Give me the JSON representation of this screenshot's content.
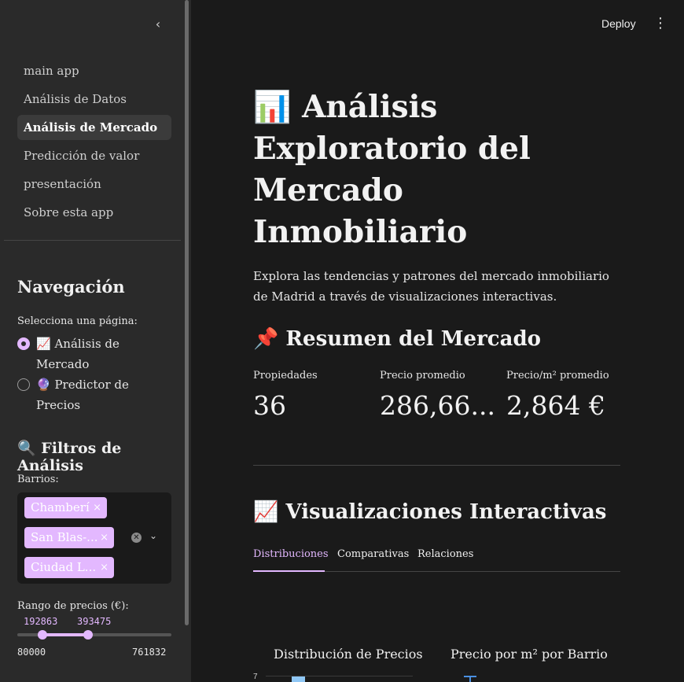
{
  "sidebar": {
    "pages": [
      {
        "label": "main app",
        "active": false
      },
      {
        "label": "Análisis de Datos",
        "active": false
      },
      {
        "label": "Análisis de Mercado",
        "active": true
      },
      {
        "label": "Predicción de valor",
        "active": false
      },
      {
        "label": "presentación",
        "active": false
      },
      {
        "label": "Sobre esta app",
        "active": false
      }
    ],
    "nav_heading": "Navegación",
    "select_label": "Selecciona una página:",
    "radio_options": [
      {
        "label": "📈 Análisis de Mercado",
        "selected": true
      },
      {
        "label": "🔮 Predictor de Precios",
        "selected": false
      }
    ],
    "filters_heading": "🔍 Filtros de Análisis",
    "barrios_label": "Barrios:",
    "barrios_selected": [
      "Chamberí",
      "San Blas-...",
      "Ciudad L..."
    ],
    "chip_remove": "×",
    "price_range_label": "Rango de precios (€):",
    "price_range": {
      "min": 80000,
      "max": 761832,
      "low": 192863,
      "high": 393475
    },
    "price_min_text": "80000",
    "price_max_text": "761832",
    "price_low_text": "192863",
    "price_high_text": "393475"
  },
  "header": {
    "deploy_label": "Deploy",
    "menu_icon": "vertical-dots-icon"
  },
  "main": {
    "title": "📊 Análisis Exploratorio del Mercado Inmobiliario",
    "intro": "Explora las tendencias y patrones del mercado inmobiliario de Madrid a través de visualizaciones interactivas.",
    "summary_heading": "📌 Resumen del Mercado",
    "metrics": [
      {
        "label": "Propiedades",
        "value": "36"
      },
      {
        "label": "Precio promedio",
        "value": "286,66..."
      },
      {
        "label": "Precio/m² promedio",
        "value": "2,864 €"
      }
    ],
    "viz_heading": "📈 Visualizaciones Interactivas",
    "tabs": [
      {
        "label": "Distribuciones",
        "active": true
      },
      {
        "label": "Comparativas",
        "active": false
      },
      {
        "label": "Relaciones",
        "active": false
      }
    ],
    "chart_titles": [
      "Distribución de Precios",
      "Precio por m² por Barrio"
    ],
    "chart_tick_top": "7"
  },
  "colors": {
    "accent": "#e3b8ff",
    "sidebar_bg": "#2a2a2a",
    "main_bg": "#1a1a1a"
  }
}
